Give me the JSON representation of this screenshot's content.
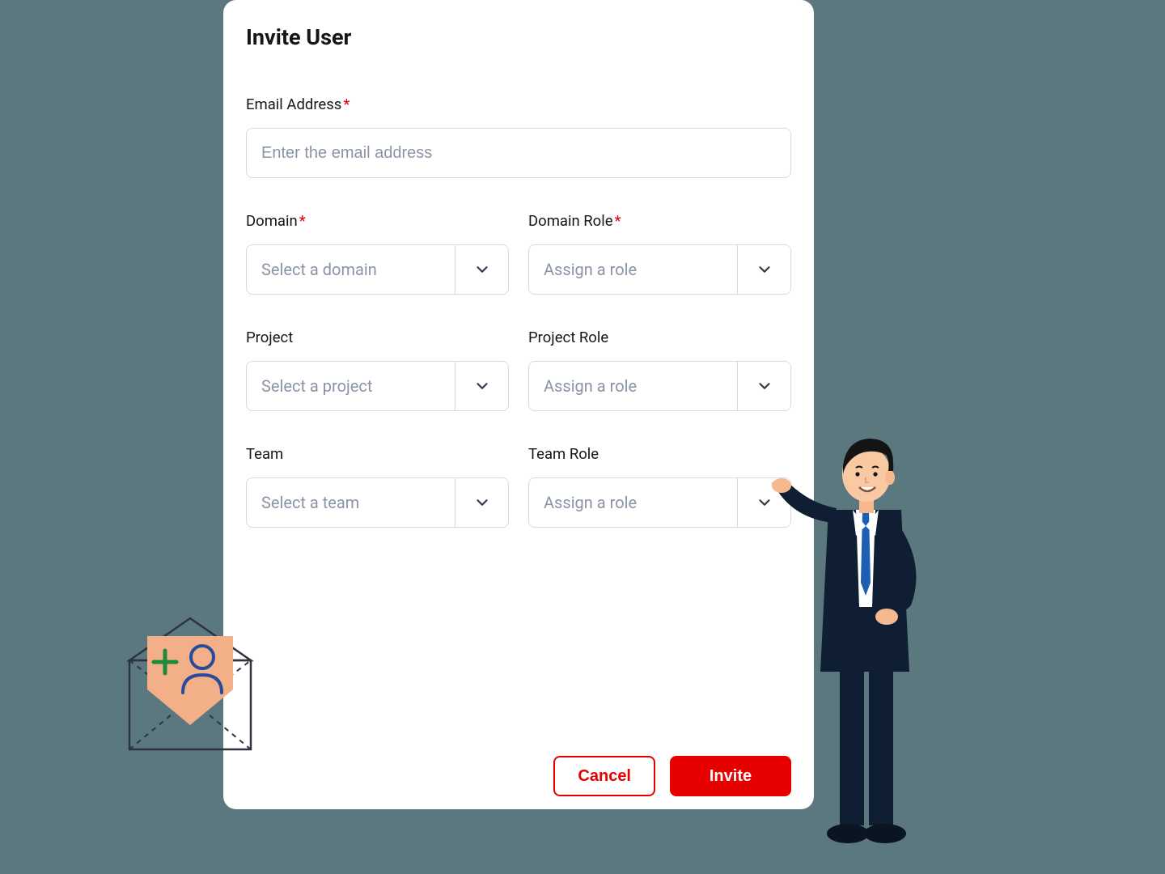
{
  "modal": {
    "title": "Invite User",
    "email": {
      "label": "Email Address",
      "required": true,
      "placeholder": "Enter the email address",
      "value": ""
    },
    "domain": {
      "label": "Domain",
      "required": true,
      "placeholder": "Select a domain"
    },
    "domain_role": {
      "label": "Domain Role",
      "required": true,
      "placeholder": "Assign a role"
    },
    "project": {
      "label": "Project",
      "required": false,
      "placeholder": "Select a project"
    },
    "project_role": {
      "label": "Project Role",
      "required": false,
      "placeholder": "Assign a role"
    },
    "team": {
      "label": "Team",
      "required": false,
      "placeholder": "Select a team"
    },
    "team_role": {
      "label": "Team Role",
      "required": false,
      "placeholder": "Assign a role"
    },
    "actions": {
      "cancel": "Cancel",
      "invite": "Invite"
    }
  },
  "required_marker": "*"
}
